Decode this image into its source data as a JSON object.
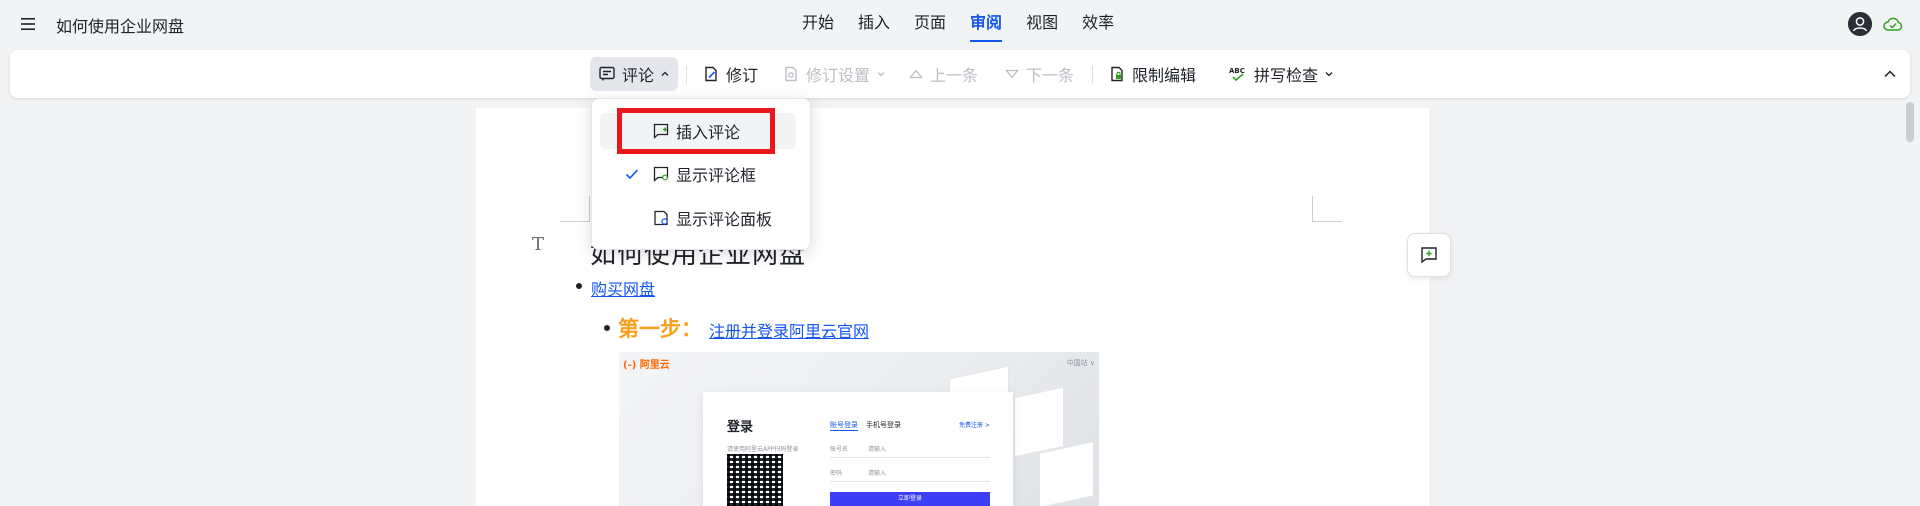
{
  "header": {
    "doc_title": "如何使用企业网盘",
    "tabs": [
      {
        "label": "开始"
      },
      {
        "label": "插入"
      },
      {
        "label": "页面"
      },
      {
        "label": "审阅",
        "active": true
      },
      {
        "label": "视图"
      },
      {
        "label": "效率"
      }
    ]
  },
  "toolbar": {
    "comment": "评论",
    "revise": "修订",
    "revise_settings": "修订设置",
    "prev": "上一条",
    "next": "下一条",
    "restrict_edit": "限制编辑",
    "spell_check": "拼写检查"
  },
  "dropdown": {
    "items": [
      {
        "label": "插入评论",
        "checked": false
      },
      {
        "label": "显示评论框",
        "checked": true
      },
      {
        "label": "显示评论面板",
        "checked": false
      }
    ]
  },
  "document": {
    "heading": "如何使用企业网盘",
    "bullet1_link": "购买网盘",
    "step_label": "第一步：",
    "step_link": "注册并登录阿里云官网",
    "embed": {
      "logo": "(-) 阿里云",
      "lang": "中国站 ∨",
      "login_title": "登录",
      "login_sub": "请使用阿里云APP扫码登录",
      "tab_account": "账号登录",
      "tab_phone": "手机号登录",
      "register": "免费注册 >",
      "field_account_label": "账号名",
      "field_account_ph": "请输入",
      "field_password_label": "密码",
      "field_password_ph": "请输入",
      "login_button": "立即登录"
    }
  },
  "colors": {
    "accent": "#1456f0",
    "highlight": "#e8181e",
    "step": "#f7a01d"
  }
}
